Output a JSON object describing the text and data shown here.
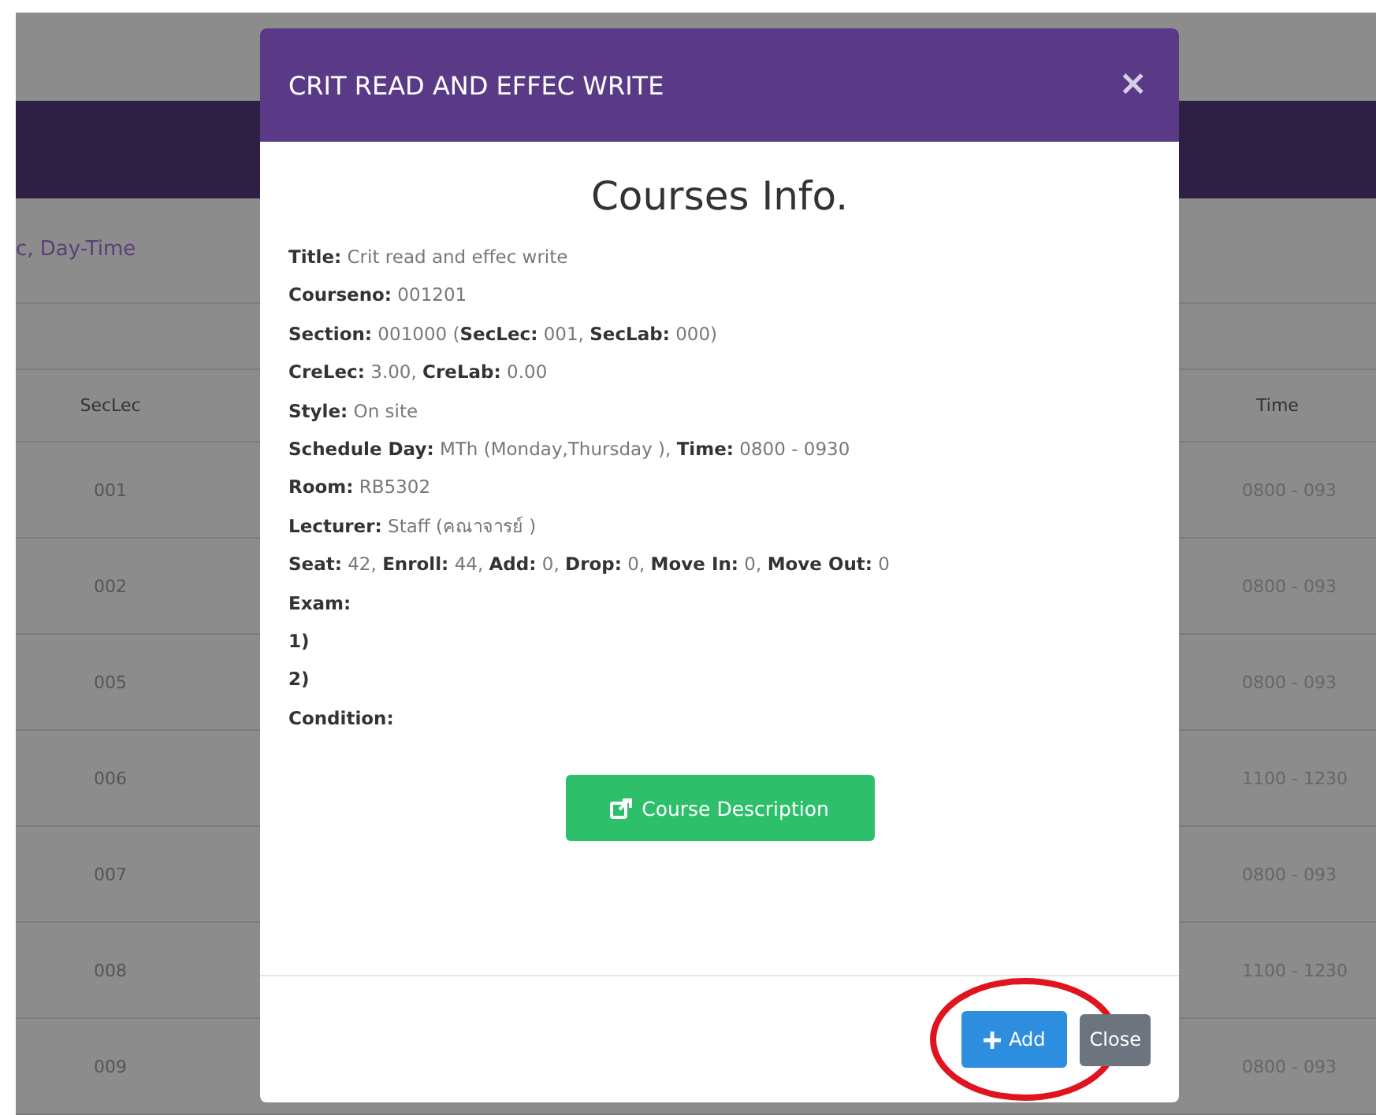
{
  "page": {
    "filter_text": "c, Day-Time",
    "table": {
      "columns": [
        "SecLec",
        "Time"
      ],
      "rows": [
        {
          "secLec": "001",
          "time": "0800 - 093"
        },
        {
          "secLec": "002",
          "time": "0800 - 093"
        },
        {
          "secLec": "005",
          "time": "0800 - 093"
        },
        {
          "secLec": "006",
          "time": "1100 - 1230"
        },
        {
          "secLec": "007",
          "time": "0800 - 093"
        },
        {
          "secLec": "008",
          "time": "1100 - 1230"
        },
        {
          "secLec": "009",
          "time": "0800 - 093"
        }
      ]
    }
  },
  "modal": {
    "title": "CRIT READ AND EFFEC WRITE",
    "close_symbol": "×",
    "heading": "Courses Info.",
    "lines": [
      "**Title:** Crit read and effec write",
      "**Courseno:** 001201",
      "**Section:** 001000 (**SecLec:** 001, **SecLab:** 000)",
      "**CreLec:** 3.00, **CreLab:** 0.00",
      "**Style:** On site",
      "**Schedule Day:** MTh (Monday,Thursday ), **Time:** 0800 - 0930",
      "**Room:** RB5302",
      "**Lecturer:** Staff (คณาจารย์ )",
      "**Seat:** 42, **Enroll:** 44, **Add:** 0, **Drop:** 0, **Move In:** 0, **Move Out:** 0",
      "**Exam:**",
      "**1)**",
      "**2)**",
      "**Condition:**"
    ],
    "description_button": "Course Description",
    "footer_buttons": [
      {
        "kind": "primary",
        "label": "Add",
        "highlighted": true
      },
      {
        "kind": "secondary",
        "label": "Close",
        "highlighted": false
      }
    ]
  }
}
